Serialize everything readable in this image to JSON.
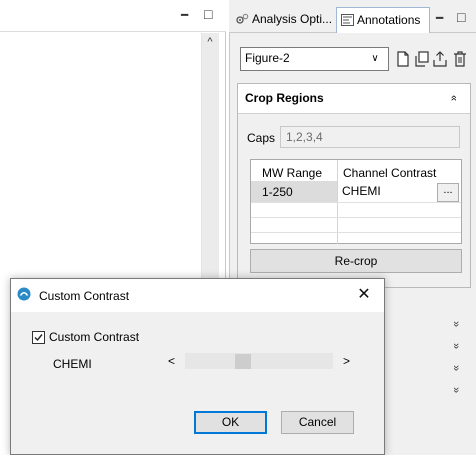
{
  "left_panel": {
    "minimize": "━",
    "maximize": "□",
    "scroll_up": "^"
  },
  "right_panel": {
    "tabs": [
      {
        "label": "Analysis Opti...",
        "icon": "gear-icon",
        "active": false
      },
      {
        "label": "Annotations",
        "icon": "annotations-icon",
        "active": true
      }
    ],
    "minimize": "━",
    "maximize": "□",
    "figure_select": {
      "value": "Figure-2",
      "arrow": "∨"
    },
    "toolbar_icons": [
      "new-document-icon",
      "copy-icon",
      "export-icon",
      "delete-icon"
    ],
    "crop_regions": {
      "title": "Crop Regions",
      "collapse": "»",
      "caps_label": "Caps",
      "caps_value": "1,2,3,4",
      "table": {
        "headers": [
          "MW Range",
          "Channel Contrast"
        ],
        "rows": [
          {
            "range": "1-250",
            "contrast": "CHEMI",
            "button": "..."
          }
        ]
      },
      "recrop_label": "Re-crop"
    },
    "collapsed_chevron": "»"
  },
  "dialog": {
    "title": "Custom Contrast",
    "close": "✕",
    "checkbox_label": "Custom Contrast",
    "checkbox_checked": true,
    "channel_label": "CHEMI",
    "slider_left": "<",
    "slider_right": ">",
    "slider_value_fraction": 0.38,
    "ok_label": "OK",
    "cancel_label": "Cancel"
  },
  "colors": {
    "accent": "#0078d7",
    "app_icon": "#2a8ac6"
  }
}
